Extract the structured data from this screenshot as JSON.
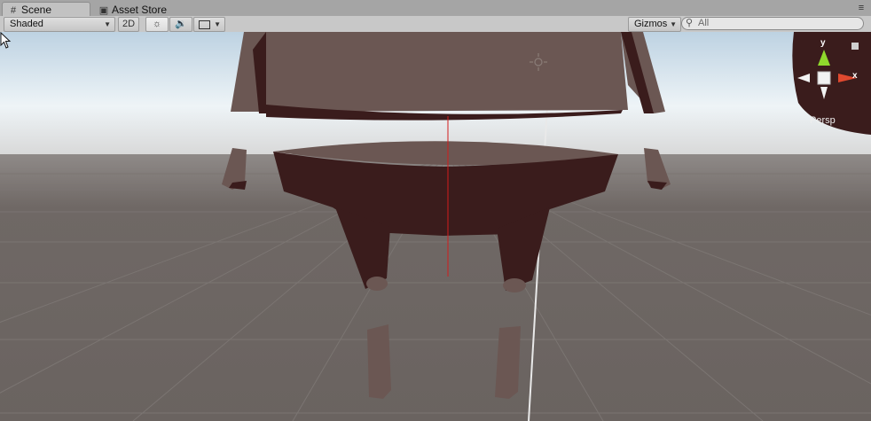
{
  "tabs": [
    {
      "label": "Scene",
      "icon": "grid-icon",
      "active": true
    },
    {
      "label": "Asset Store",
      "icon": "shopping-bag-icon",
      "active": false
    }
  ],
  "toolbar": {
    "draw_mode": "Shaded",
    "mode_2d": "2D",
    "lighting_icon": "sun-icon",
    "audio_icon": "speaker-icon",
    "effects_icon": "image-icon",
    "gizmos": "Gizmos",
    "search_placeholder": "All"
  },
  "scene_gizmo": {
    "projection": "Persp",
    "y_label": "y",
    "x_label": "x",
    "colors": {
      "y": "#8fd82c",
      "x": "#e0492f"
    }
  },
  "colors": {
    "model_light": "#6a5652",
    "model_dark": "#3a1c1c",
    "ground": "#6b6461"
  }
}
